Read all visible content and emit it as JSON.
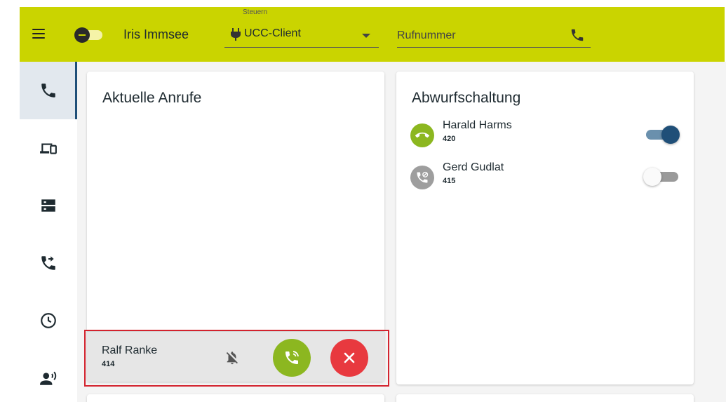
{
  "colors": {
    "brand_bar": "#cad400",
    "accent_blue": "#1f4f78",
    "accept_green": "#8cb720",
    "reject_red": "#e8393f",
    "highlight_red": "#d3232e"
  },
  "header": {
    "menu_icon": "hamburger-menu-icon",
    "presence_status": "do-not-disturb",
    "user_name": "Iris Immsee",
    "device_label": "Steuern",
    "device_icon": "plug-icon",
    "device_value": "UCC-Client",
    "number_placeholder": "Rufnummer",
    "call_icon": "phone-icon"
  },
  "sidebar": {
    "items": [
      {
        "id": "calls",
        "icon": "phone-icon",
        "active": true
      },
      {
        "id": "devices",
        "icon": "devices-icon",
        "active": false
      },
      {
        "id": "servers",
        "icon": "server-icon",
        "active": false
      },
      {
        "id": "forwarding",
        "icon": "phone-forward-icon",
        "active": false
      },
      {
        "id": "history",
        "icon": "clock-icon",
        "active": false
      },
      {
        "id": "voicemail",
        "icon": "person-voice-icon",
        "active": false
      }
    ]
  },
  "current_calls": {
    "title": "Aktuelle Anrufe",
    "calls": [
      {
        "name": "Ralf Ranke",
        "number": "414",
        "mute_icon": "bell-off-icon",
        "accept_icon": "phone-ring-icon",
        "reject_icon": "close-icon"
      }
    ]
  },
  "forwarding": {
    "title": "Abwurfschaltung",
    "entries": [
      {
        "name": "Harald Harms",
        "number": "420",
        "enabled": true,
        "avatar_icon": "phone-hangup-icon",
        "avatar_color": "#8cb720"
      },
      {
        "name": "Gerd Gudlat",
        "number": "415",
        "enabled": false,
        "avatar_icon": "phone-off-icon",
        "avatar_color": "#9e9e9e"
      }
    ]
  }
}
